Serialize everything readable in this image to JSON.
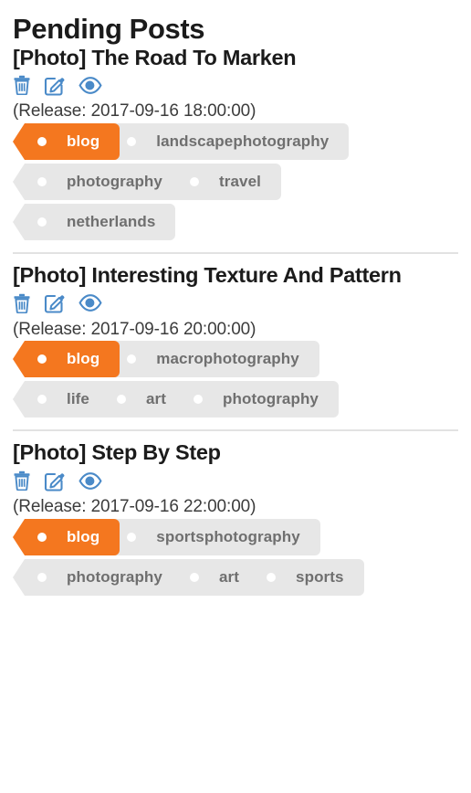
{
  "page": {
    "title": "Pending Posts"
  },
  "icons": {
    "delete": "trash-icon",
    "edit": "edit-pencil-icon",
    "view": "eye-icon"
  },
  "colors": {
    "primary_tag": "#f4771f",
    "tag_background": "#e7e7e7",
    "tag_text": "#6f6f6f",
    "icon_blue": "#4a8ac8",
    "divider": "#e2e2e2"
  },
  "posts": [
    {
      "title": "[Photo] The Road To Marken",
      "release": "(Release: 2017-09-16 18:00:00)",
      "show_divider": false,
      "tag_rows": [
        [
          {
            "label": "blog",
            "primary": true
          },
          {
            "label": "landscapephotography",
            "primary": false
          }
        ],
        [
          {
            "label": "photography",
            "primary": false
          },
          {
            "label": "travel",
            "primary": false
          }
        ],
        [
          {
            "label": "netherlands",
            "primary": false
          }
        ]
      ]
    },
    {
      "title": "[Photo] Interesting Texture And Pattern",
      "release": "(Release: 2017-09-16 20:00:00)",
      "show_divider": true,
      "tag_rows": [
        [
          {
            "label": "blog",
            "primary": true
          },
          {
            "label": "macrophotography",
            "primary": false
          }
        ],
        [
          {
            "label": "life",
            "primary": false
          },
          {
            "label": "art",
            "primary": false
          },
          {
            "label": "photography",
            "primary": false
          }
        ]
      ]
    },
    {
      "title": "[Photo] Step By Step",
      "release": "(Release: 2017-09-16 22:00:00)",
      "show_divider": true,
      "tag_rows": [
        [
          {
            "label": "blog",
            "primary": true
          },
          {
            "label": "sportsphotography",
            "primary": false
          }
        ],
        [
          {
            "label": "photography",
            "primary": false
          },
          {
            "label": "art",
            "primary": false
          },
          {
            "label": "sports",
            "primary": false
          }
        ]
      ]
    }
  ]
}
